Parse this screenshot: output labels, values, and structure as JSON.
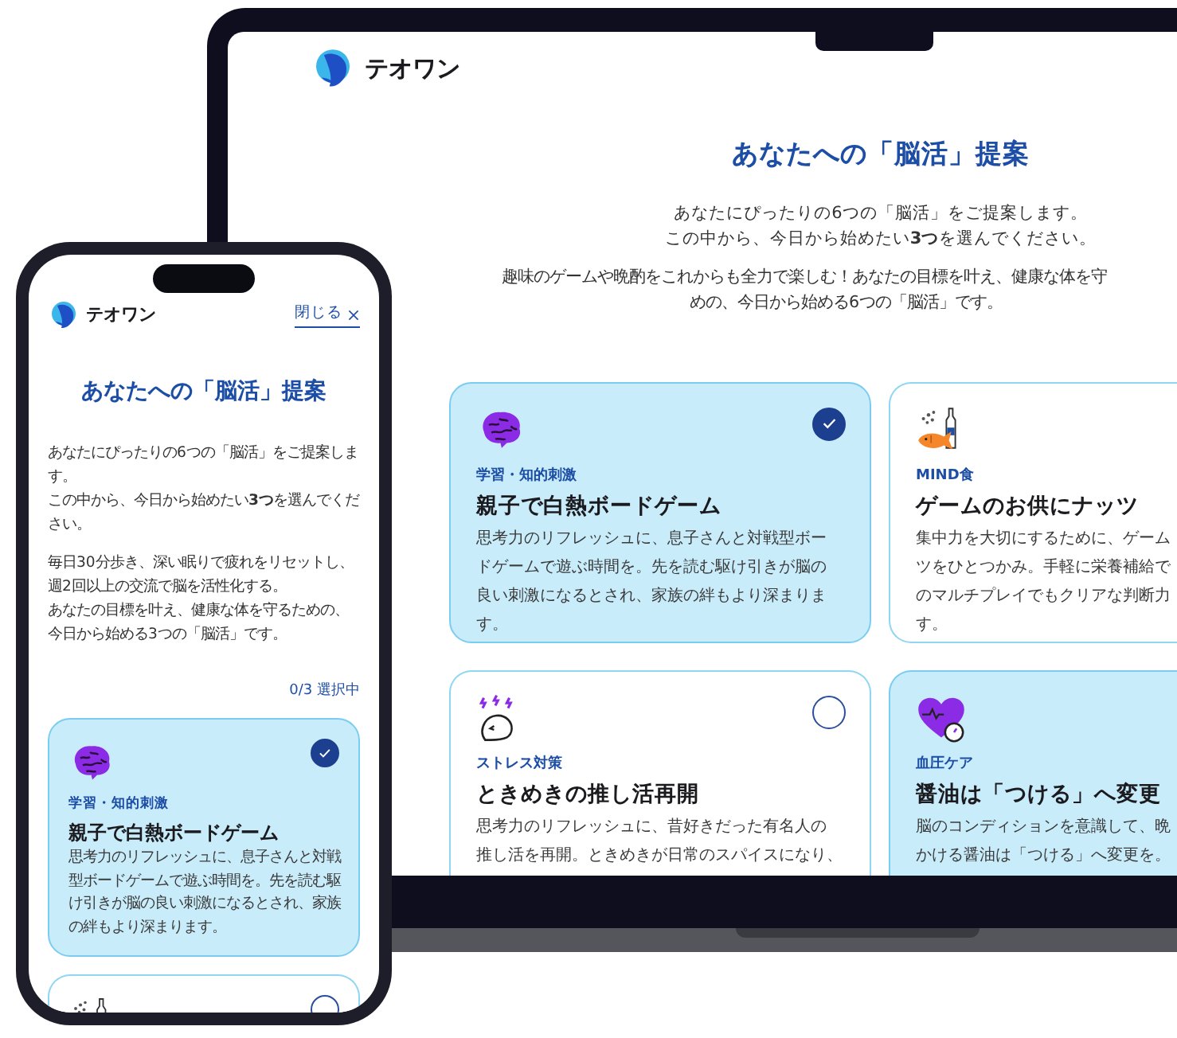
{
  "laptop": {
    "brand": "テオワン",
    "heading": "あなたへの「脳活」提案",
    "intro": [
      "あなたにぴったりの6つの「脳活」をご提案します。",
      "この中から、今日から始めたい**3つ**を選んでください。"
    ],
    "note": [
      "趣味のゲームや晩酌をこれからも全力で楽しむ！あなたの目標を叶え、健康な体を守",
      "めの、今日から始める6つの「脳活」です。"
    ],
    "cards": [
      {
        "kind": "brain",
        "category": "学習・知的刺激",
        "title": "親子で白熱ボードゲーム",
        "lines": [
          "思考力のリフレッシュに、息子さんと対戦型ボー",
          "ドゲームで遊ぶ時間を。先を読む駆け引きが脳の",
          "良い刺激になるとされ、家族の絆もより深まりま",
          "す。"
        ],
        "selected": true,
        "check_shown": true
      },
      {
        "kind": "snack",
        "category": "MIND食",
        "title": "ゲームのお供にナッツ",
        "lines": [
          "集中力を大切にするために、ゲーム",
          "ツをひとつかみ。手軽に栄養補給で",
          "のマルチプレイでもクリアな判断力",
          "す。"
        ],
        "selected": false,
        "check_shown": false
      },
      {
        "kind": "stress",
        "category": "ストレス対策",
        "title": "ときめきの推し活再開",
        "lines": [
          "思考力のリフレッシュに、昔好きだった有名人の",
          "推し活を再開。ときめきが日常のスパイスになり、"
        ],
        "selected": false,
        "check_shown": true
      },
      {
        "kind": "heart",
        "category": "血圧ケア",
        "title": "醤油は「つける」へ変更",
        "lines": [
          "脳のコンディションを意識して、晩",
          "かける醤油は「つける」へ変更を。"
        ],
        "selected": true,
        "check_shown": false
      }
    ]
  },
  "phone": {
    "brand": "テオワン",
    "close_link": "閉じる",
    "heading": "あなたへの「脳活」提案",
    "paragraphs": [
      [
        "あなたにぴったりの6つの「脳活」をご提案します。",
        "この中から、今日から始めたい**3つ**を選んでください。"
      ],
      [
        "毎日30分歩き、深い眠りで疲れをリセットし、週2回以上の交流で脳を活性化する。",
        "あなたの目標を叶え、健康な体を守るための、今日から始める3つの「脳活」です。"
      ]
    ],
    "counter": "0/3 選択中",
    "cards": [
      {
        "kind": "brain",
        "category": "学習・知的刺激",
        "title": "親子で白熱ボードゲーム",
        "description": "思考力のリフレッシュに、息子さんと対戦型ボードゲームで遊ぶ時間を。先を読む駆け引きが脳の良い刺激になるとされ、家族の絆もより深まります。",
        "selected": true
      },
      {
        "kind": "snack",
        "selected": false
      }
    ]
  }
}
